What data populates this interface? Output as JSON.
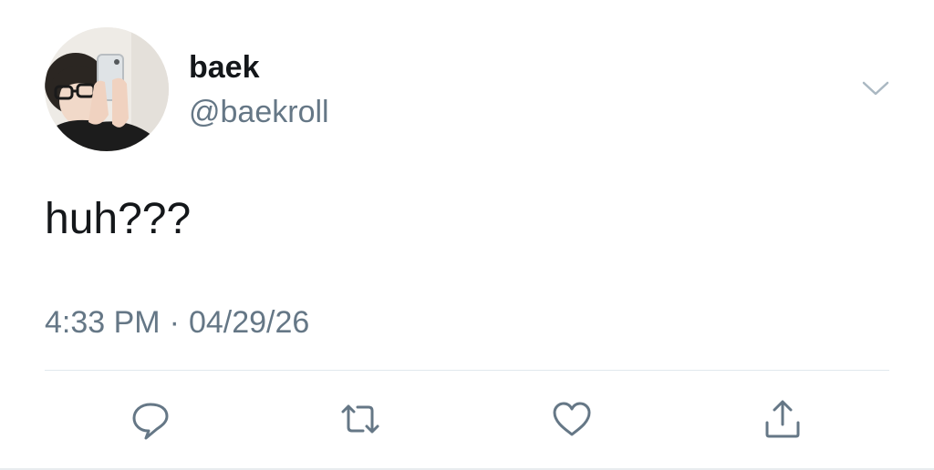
{
  "tweet": {
    "author": {
      "display_name": "baek",
      "handle": "@baekroll"
    },
    "text": "huh???",
    "time": "4:33 PM",
    "separator": "·",
    "date": "04/29/26"
  },
  "icons": {
    "menu": "chevron-down-icon",
    "reply": "reply-bubble-icon",
    "retweet": "retweet-arrows-icon",
    "like": "heart-icon",
    "share": "share-upload-icon"
  },
  "colors": {
    "text_primary": "#14171a",
    "text_secondary": "#657786",
    "icon": "#657786",
    "divider": "#e1e8ed"
  }
}
